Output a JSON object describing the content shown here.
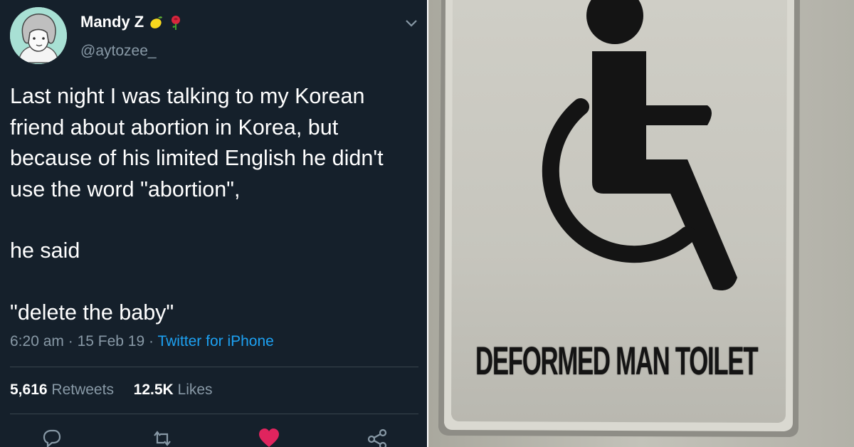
{
  "tweet": {
    "display_name": "Mandy Z",
    "handle": "@aytozee_",
    "body_lines": [
      "Last night I was talking to my Korean friend about abortion in Korea, but because of his limited English he didn't use the word \"abortion\",",
      "he said",
      "\"delete the baby\""
    ],
    "time": "6:20 am",
    "date": "15 Feb 19",
    "source": "Twitter for iPhone",
    "retweets_count": "5,616",
    "retweets_label": "Retweets",
    "likes_count": "12.5K",
    "likes_label": "Likes",
    "colors": {
      "background": "#15202b",
      "secondary_text": "#8899a6",
      "link": "#1da1f2",
      "like": "#e0245e"
    },
    "icons": [
      "lemon-emoji",
      "rose-emoji",
      "chevron-down-icon",
      "reply-icon",
      "retweet-icon",
      "like-icon",
      "share-icon"
    ]
  },
  "photo": {
    "sign_text": "DEFORMED MAN TOILET",
    "icon": "wheelchair-accessibility-icon"
  }
}
